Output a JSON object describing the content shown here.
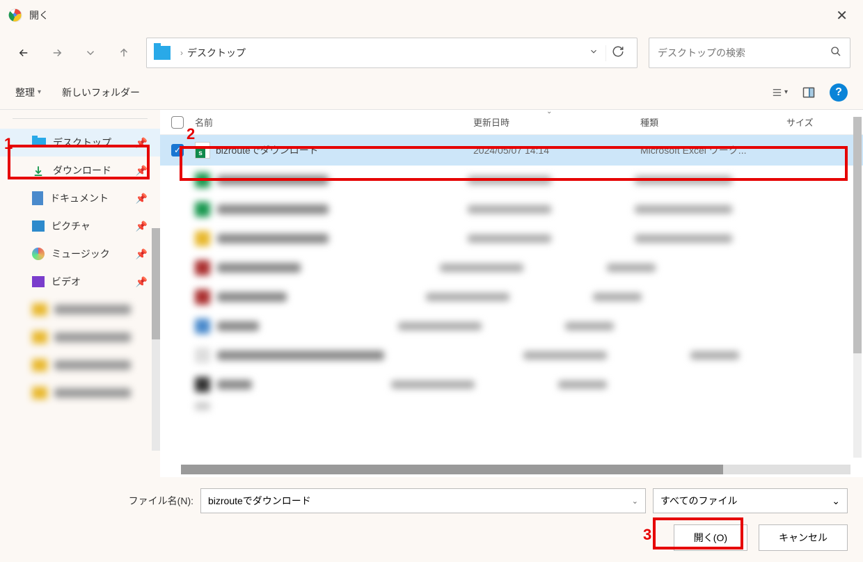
{
  "title": "開く",
  "path": {
    "location": "デスクトップ"
  },
  "search": {
    "placeholder": "デスクトップの検索"
  },
  "toolbar": {
    "organize": "整理",
    "new_folder": "新しいフォルダー"
  },
  "sidebar": {
    "items": [
      {
        "label": "デスクトップ"
      },
      {
        "label": "ダウンロード"
      },
      {
        "label": "ドキュメント"
      },
      {
        "label": "ピクチャ"
      },
      {
        "label": "ミュージック"
      },
      {
        "label": "ビデオ"
      }
    ]
  },
  "columns": {
    "name": "名前",
    "date": "更新日時",
    "type": "種類",
    "size": "サイズ"
  },
  "files": {
    "selected": {
      "name": "bizrouteでダウンロード",
      "date": "2024/05/07 14:14",
      "type": "Microsoft Excel ワーク..."
    }
  },
  "footer": {
    "filename_label": "ファイル名(N):",
    "filename_value": "bizrouteでダウンロード",
    "filter": "すべてのファイル",
    "open": "開く(O)",
    "cancel": "キャンセル"
  },
  "annotations": {
    "a1": "1",
    "a2": "2",
    "a3": "3"
  }
}
